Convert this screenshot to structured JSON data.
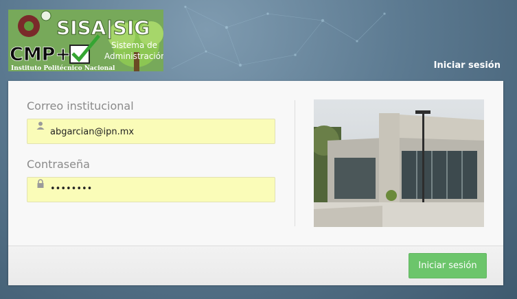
{
  "logo": {
    "brand_sisa_sig": "SISA|SIG",
    "brand_cmp": "CMP+",
    "subtitle_line1": "Sistema de",
    "subtitle_line2": "Administración",
    "institution": "Instituto Politécnico Nacional"
  },
  "header": {
    "title": "Iniciar sesión"
  },
  "form": {
    "email_label": "Correo institucional",
    "email_value": "abgarcian@ipn.mx",
    "password_label": "Contraseña",
    "password_value": "••••••••"
  },
  "footer": {
    "submit_label": "Iniciar sesión"
  },
  "colors": {
    "accent_green": "#6cc56b",
    "field_bg": "#fafcb8"
  }
}
